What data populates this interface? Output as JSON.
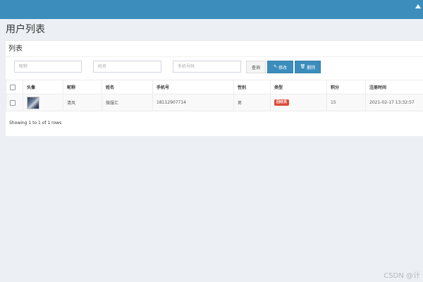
{
  "page": {
    "title": "用户列表",
    "panel_title": "列表"
  },
  "search": {
    "nickname_placeholder": "昵称",
    "name_placeholder": "姓名",
    "phone_placeholder": "手机号码",
    "query_label": "查询",
    "edit_label": "修改",
    "delete_label": "删除"
  },
  "table": {
    "headers": [
      "头像",
      "昵称",
      "姓名",
      "手机号",
      "性别",
      "类型",
      "积分",
      "注册时间"
    ],
    "rows": [
      {
        "nickname": "清风",
        "name": "微服汇",
        "phone": "18112907714",
        "gender": "男",
        "type": "回收员",
        "points": "15",
        "registered": "2021-02-17 13:32:57"
      }
    ]
  },
  "pager": {
    "summary": "Showing 1 to 1 of 1 rows"
  },
  "watermark": "CSDN @计",
  "colors": {
    "topbar": "#3c8dbc",
    "primary_button": "#3c8dbc",
    "badge": "#dd4b39",
    "background": "#ecf0f5"
  },
  "icons": {
    "edit": "edit-icon",
    "delete": "trash-icon",
    "topbar": "caret-up-icon"
  }
}
